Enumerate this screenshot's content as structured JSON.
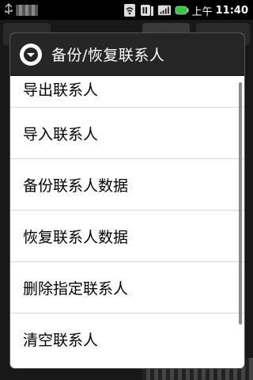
{
  "status_bar": {
    "ampm": "上午",
    "time": "11:40",
    "icons": [
      "usb-icon",
      "wifi-icon",
      "sim-icon",
      "signal-icon",
      "battery-icon"
    ]
  },
  "dialog": {
    "title": "备份/恢复联系人",
    "icon": "chevron-down-circle-icon",
    "items": [
      {
        "label": "导出联系人"
      },
      {
        "label": "导入联系人"
      },
      {
        "label": "备份联系人数据"
      },
      {
        "label": "恢复联系人数据"
      },
      {
        "label": "删除指定联系人"
      },
      {
        "label": "清空联系人"
      }
    ]
  },
  "colors": {
    "header_bg": "#262626",
    "dialog_bg": "#ffffff",
    "battery": "#2ecc40"
  }
}
